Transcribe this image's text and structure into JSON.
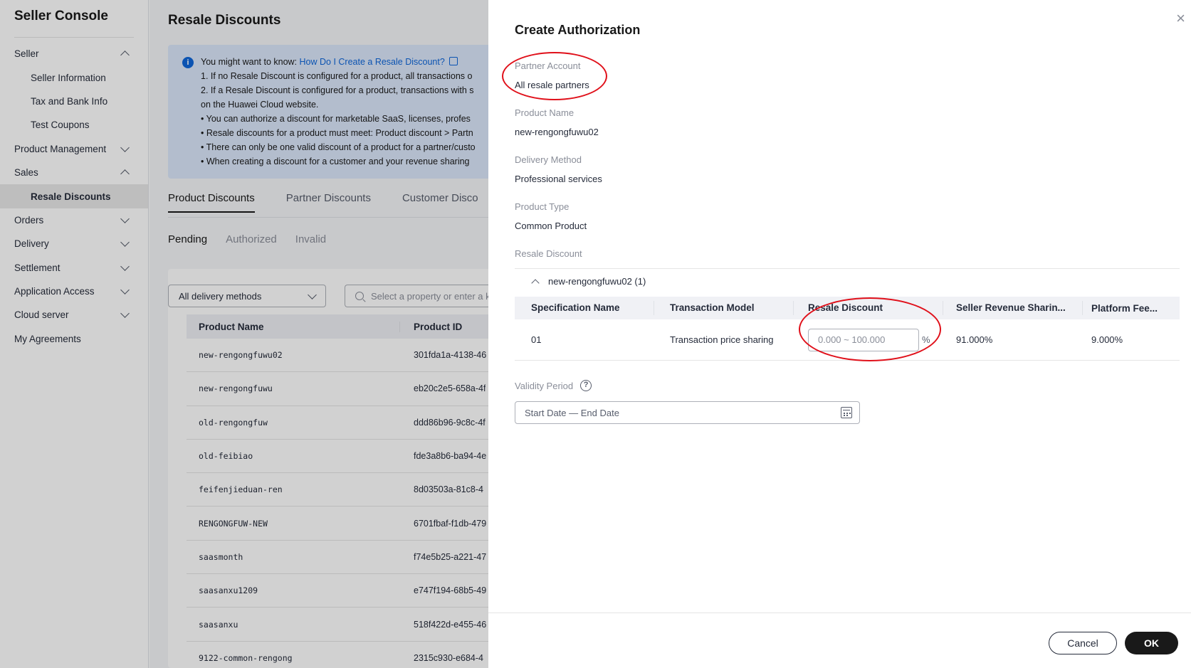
{
  "sidebar": {
    "title": "Seller Console",
    "items": [
      {
        "label": "Seller"
      },
      {
        "label": "Seller Information"
      },
      {
        "label": "Tax and Bank Info"
      },
      {
        "label": "Test Coupons"
      },
      {
        "label": "Product Management"
      },
      {
        "label": "Sales"
      },
      {
        "label": "Resale Discounts"
      },
      {
        "label": "Orders"
      },
      {
        "label": "Delivery"
      },
      {
        "label": "Settlement"
      },
      {
        "label": "Application Access"
      },
      {
        "label": "Cloud server"
      },
      {
        "label": "My Agreements"
      }
    ]
  },
  "page": {
    "title": "Resale Discounts",
    "notice": {
      "intro": "You might want to know:",
      "link": "How Do I Create a Resale Discount?",
      "lines": [
        "1. If no Resale Discount is configured for a product, all transactions o",
        "2. If a Resale Discount is configured for a product, transactions with s",
        "on the Huawei Cloud website.",
        "• You can authorize a discount for marketable SaaS, licenses, profes",
        "• Resale discounts for a product must meet: Product discount > Partn",
        "• There can only be one valid discount of a product for a partner/custo",
        "• When creating a discount for a customer and your revenue sharing"
      ]
    },
    "tabs": [
      "Product Discounts",
      "Partner Discounts",
      "Customer Disco"
    ],
    "subtabs": [
      "Pending",
      "Authorized",
      "Invalid"
    ],
    "filter": {
      "delivery": "All delivery methods",
      "search_placeholder": "Select a property or enter a keyword"
    },
    "table": {
      "headers": [
        "Product Name",
        "Product ID"
      ],
      "rows": [
        [
          "new-rengongfuwu02",
          "301fda1a-4138-46"
        ],
        [
          "new-rengongfuwu",
          "eb20c2e5-658a-4f"
        ],
        [
          "old-rengongfuw",
          "ddd86b96-9c8c-4f"
        ],
        [
          "old-feibiao",
          "fde3a8b6-ba94-4e"
        ],
        [
          "feifenjieduan-ren",
          "8d03503a-81c8-4"
        ],
        [
          "RENGONGFUW-NEW",
          "6701fbaf-f1db-479"
        ],
        [
          "saasmonth",
          "f74e5b25-a221-47"
        ],
        [
          "saasanxu1209",
          "e747f194-68b5-49"
        ],
        [
          "saasanxu",
          "518f422d-e455-46"
        ],
        [
          "9122-common-rengong",
          "2315c930-e684-4"
        ]
      ]
    }
  },
  "drawer": {
    "title": "Create Authorization",
    "close": "×",
    "fields": {
      "partner_account_label": "Partner Account",
      "partner_account_value": "All resale partners",
      "product_name_label": "Product Name",
      "product_name_value": "new-rengongfuwu02",
      "delivery_method_label": "Delivery Method",
      "delivery_method_value": "Professional services",
      "product_type_label": "Product Type",
      "product_type_value": "Common Product",
      "resale_discount_label": "Resale Discount"
    },
    "group": "new-rengongfuwu02 (1)",
    "table": {
      "headers": [
        "Specification Name",
        "Transaction Model",
        "Resale Discount",
        "Seller Revenue Sharin...",
        "Platform Fee..."
      ],
      "row": {
        "spec": "01",
        "model": "Transaction price sharing",
        "discount_placeholder": "0.000 ~ 100.000",
        "unit": "%",
        "seller_share": "91.000%",
        "platform_fee": "9.000%"
      }
    },
    "validity_label": "Validity Period",
    "validity_help": "?",
    "date_placeholder": "Start Date — End Date",
    "buttons": {
      "cancel": "Cancel",
      "ok": "OK"
    }
  },
  "colors": {
    "accent": "#0e66d9",
    "annotation": "#e0101a",
    "primary_button": "#191919"
  }
}
